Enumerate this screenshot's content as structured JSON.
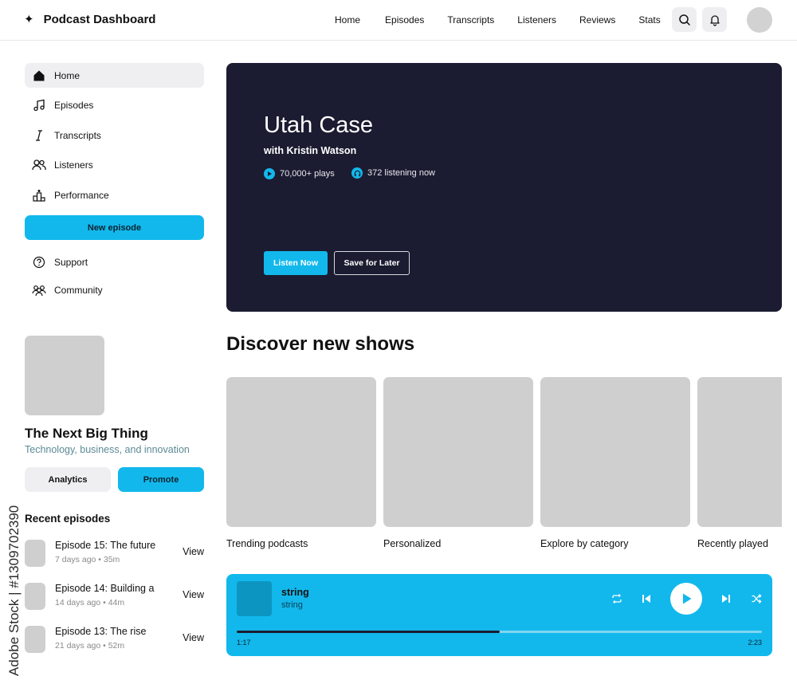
{
  "header": {
    "brand_icon": "sparkle-icon",
    "title": "Podcast Dashboard",
    "nav": [
      "Home",
      "Episodes",
      "Transcripts",
      "Listeners",
      "Reviews",
      "Stats"
    ]
  },
  "sidebar": {
    "items": [
      {
        "label": "Home",
        "icon": "home-icon",
        "active": true
      },
      {
        "label": "Episodes",
        "icon": "music-note-icon"
      },
      {
        "label": "Transcripts",
        "icon": "italic-text-icon"
      },
      {
        "label": "Listeners",
        "icon": "users-icon"
      },
      {
        "label": "Performance",
        "icon": "podium-icon"
      }
    ],
    "new_episode_label": "New episode",
    "secondary": [
      {
        "label": "Support",
        "icon": "help-circle-icon"
      },
      {
        "label": "Community",
        "icon": "community-icon"
      }
    ]
  },
  "show": {
    "title": "The Next Big Thing",
    "subtitle": "Technology, business, and innovation",
    "analytics_label": "Analytics",
    "promote_label": "Promote"
  },
  "recent": {
    "heading": "Recent episodes",
    "episodes": [
      {
        "title": "Episode 15: The future",
        "meta": "7 days ago • 35m",
        "action": "View"
      },
      {
        "title": "Episode 14: Building a",
        "meta": "14 days ago • 44m",
        "action": "View"
      },
      {
        "title": "Episode 13: The rise",
        "meta": "21 days ago • 52m",
        "action": "View"
      }
    ]
  },
  "hero": {
    "title": "Utah Case",
    "host": "with Kristin Watson",
    "plays": "70,000+ plays",
    "listening": "372 listening now",
    "listen_label": "Listen Now",
    "save_label": "Save for Later"
  },
  "discover": {
    "heading": "Discover new shows",
    "cards": [
      "Trending podcasts",
      "Personalized",
      "Explore by category",
      "Recently played"
    ]
  },
  "player": {
    "title": "string",
    "subtitle": "string",
    "elapsed": "1:17",
    "duration": "2:23",
    "progress": 0.5
  },
  "watermark": "Adobe Stock | #1309702390",
  "colors": {
    "accent": "#12b8ec",
    "hero_bg": "#1b1c31",
    "placeholder": "#cfcfcf"
  }
}
